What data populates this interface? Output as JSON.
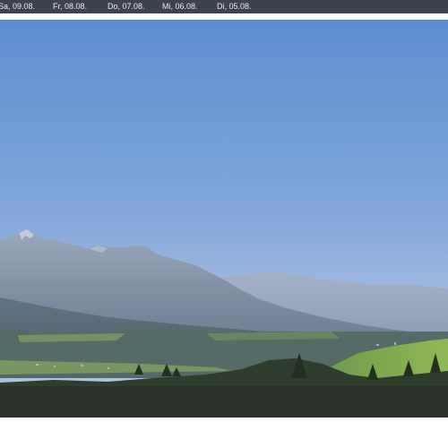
{
  "date_nav": {
    "items": [
      {
        "label": "Sa, 09.08."
      },
      {
        "label": "Fr, 08.08."
      },
      {
        "label": "Do, 07.08."
      },
      {
        "label": "Mi, 06.08."
      },
      {
        "label": "Di, 05.08."
      }
    ]
  },
  "colors": {
    "nav_background": "#3d4250",
    "nav_text": "#e9ecf2",
    "sky_top": "#5f8fd0",
    "sky_horizon": "#a9c2de"
  }
}
